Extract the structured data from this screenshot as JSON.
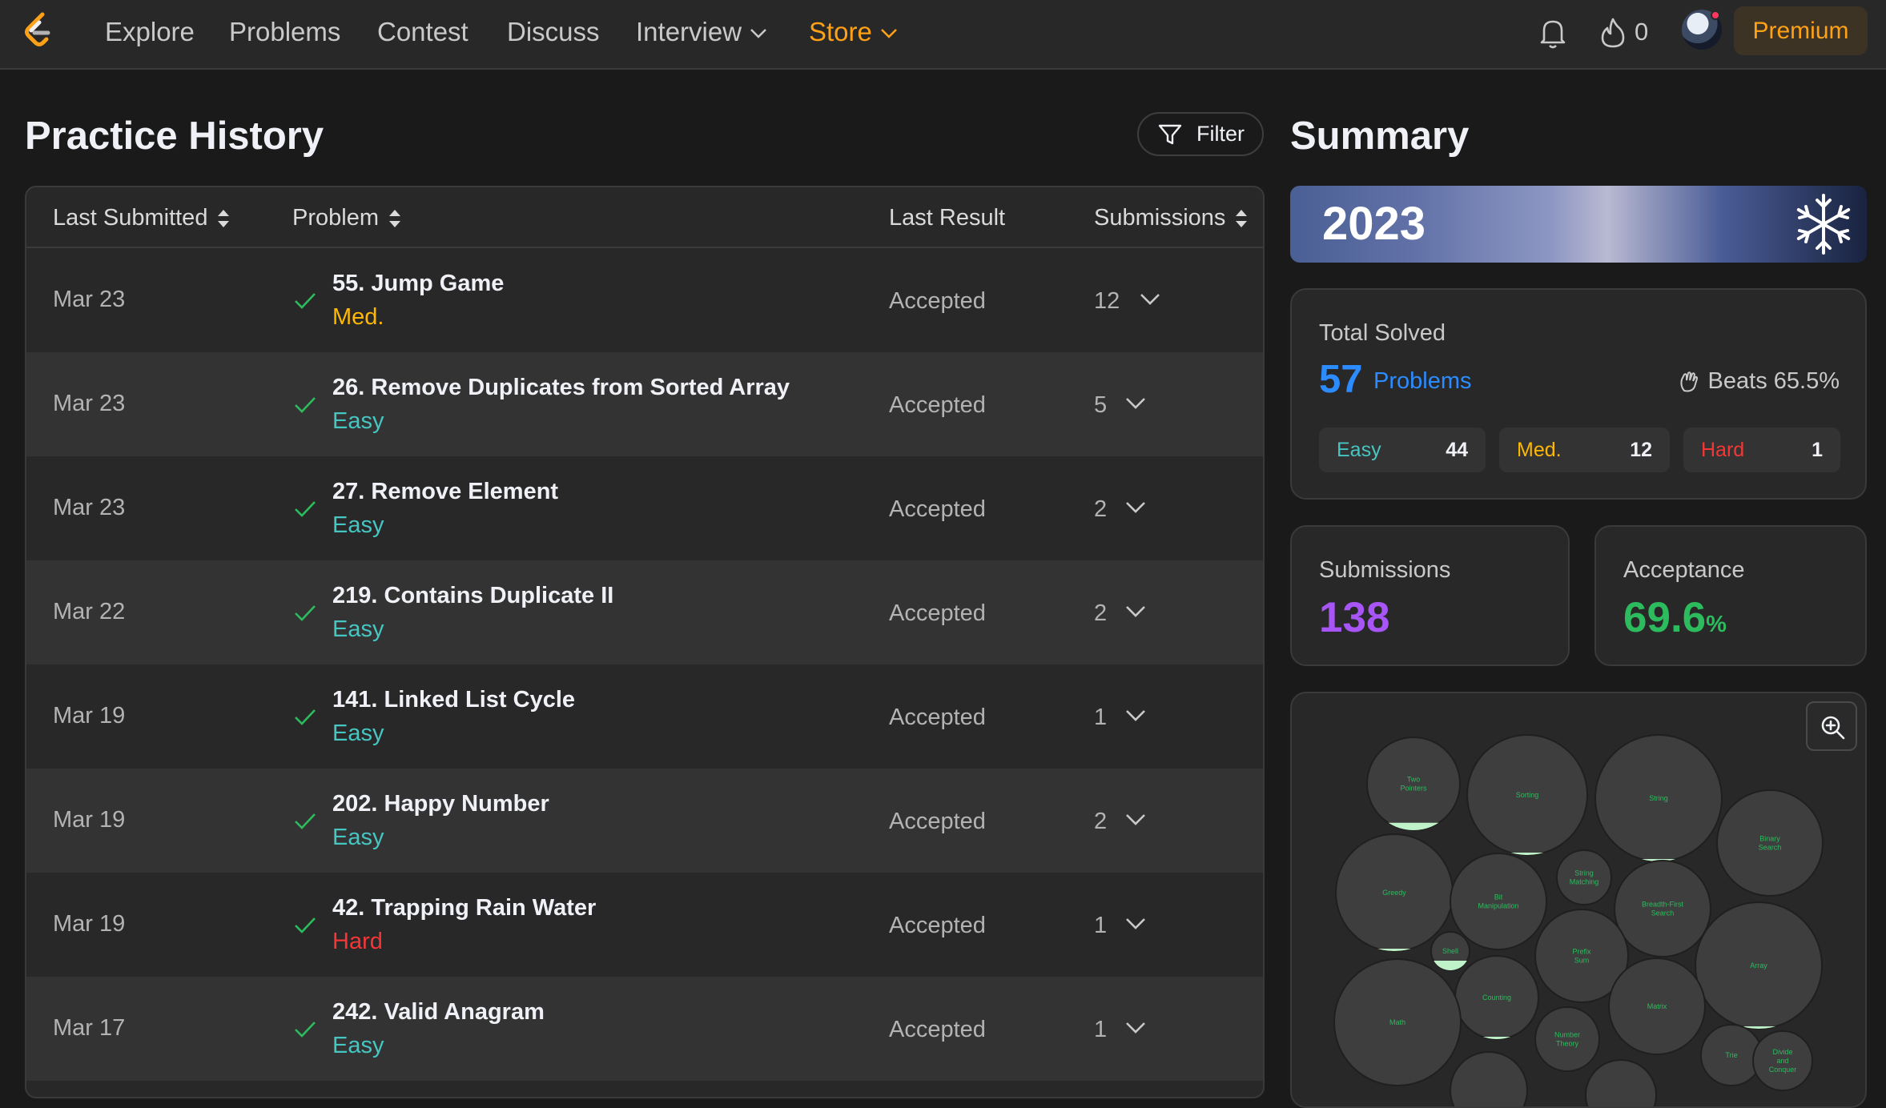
{
  "nav": {
    "items": [
      {
        "label": "Explore"
      },
      {
        "label": "Problems"
      },
      {
        "label": "Contest"
      },
      {
        "label": "Discuss"
      },
      {
        "label": "Interview"
      },
      {
        "label": "Store"
      }
    ],
    "streak_count": "0",
    "premium_label": "Premium",
    "icons": [
      "logo-icon",
      "chevron-down-icon",
      "bell-icon",
      "fire-icon",
      "avatar"
    ],
    "accent_color": "#ffa116"
  },
  "history": {
    "title": "Practice History",
    "filter_label": "Filter",
    "columns": [
      "Last Submitted",
      "Problem",
      "Last Result",
      "Submissions"
    ],
    "rows": [
      {
        "date": "Mar 23",
        "title": "55. Jump Game",
        "difficulty": "Med.",
        "result": "Accepted",
        "submissions": "12"
      },
      {
        "date": "Mar 23",
        "title": "26. Remove Duplicates from Sorted Array",
        "difficulty": "Easy",
        "result": "Accepted",
        "submissions": "5"
      },
      {
        "date": "Mar 23",
        "title": "27. Remove Element",
        "difficulty": "Easy",
        "result": "Accepted",
        "submissions": "2"
      },
      {
        "date": "Mar 22",
        "title": "219. Contains Duplicate II",
        "difficulty": "Easy",
        "result": "Accepted",
        "submissions": "2"
      },
      {
        "date": "Mar 19",
        "title": "141. Linked List Cycle",
        "difficulty": "Easy",
        "result": "Accepted",
        "submissions": "1"
      },
      {
        "date": "Mar 19",
        "title": "202. Happy Number",
        "difficulty": "Easy",
        "result": "Accepted",
        "submissions": "2"
      },
      {
        "date": "Mar 19",
        "title": "42. Trapping Rain Water",
        "difficulty": "Hard",
        "result": "Accepted",
        "submissions": "1"
      },
      {
        "date": "Mar 17",
        "title": "242. Valid Anagram",
        "difficulty": "Easy",
        "result": "Accepted",
        "submissions": "1"
      }
    ],
    "colors": {
      "easy": "#46c6c2",
      "med": "#ffb800",
      "hard": "#f63636",
      "accepted_check": "#2cbb5d"
    }
  },
  "summary": {
    "title": "Summary",
    "year": "2023",
    "total_solved_label": "Total Solved",
    "total_solved": "57",
    "total_solved_unit": "Problems",
    "beats": "Beats 65.5%",
    "breakdown": [
      {
        "label": "Easy",
        "count": "44"
      },
      {
        "label": "Med.",
        "count": "12"
      },
      {
        "label": "Hard",
        "count": "1"
      }
    ],
    "submissions_label": "Submissions",
    "submissions": "138",
    "acceptance_label": "Acceptance",
    "acceptance": "69.6",
    "acceptance_unit": "%",
    "colors": {
      "solved": "#2c8cff",
      "submissions": "#a855f7",
      "acceptance": "#2cbb5d"
    }
  },
  "skills": {
    "bubbles": [
      {
        "label": "Two Pointers",
        "fill": 0.08
      },
      {
        "label": "Sorting",
        "fill": 0.01
      },
      {
        "label": "String",
        "fill": 0.01
      },
      {
        "label": "Binary Search",
        "fill": 0
      },
      {
        "label": "Greedy",
        "fill": 0.01
      },
      {
        "label": "Bit Manipulation",
        "fill": 0
      },
      {
        "label": "String Matching",
        "fill": 0
      },
      {
        "label": "Breadth-First Search",
        "fill": 0
      },
      {
        "label": "Shell",
        "fill": 0.25
      },
      {
        "label": "Prefix Sum",
        "fill": 0
      },
      {
        "label": "Array",
        "fill": 0.01
      },
      {
        "label": "Counting",
        "fill": 0.01
      },
      {
        "label": "Math",
        "fill": 0
      },
      {
        "label": "Number Theory",
        "fill": 0
      },
      {
        "label": "Matrix",
        "fill": 0
      },
      {
        "label": "Trie",
        "fill": 0
      },
      {
        "label": "Divide and Conquer",
        "fill": 0
      },
      {
        "label": "",
        "fill": 0
      },
      {
        "label": "",
        "fill": 0
      }
    ]
  }
}
